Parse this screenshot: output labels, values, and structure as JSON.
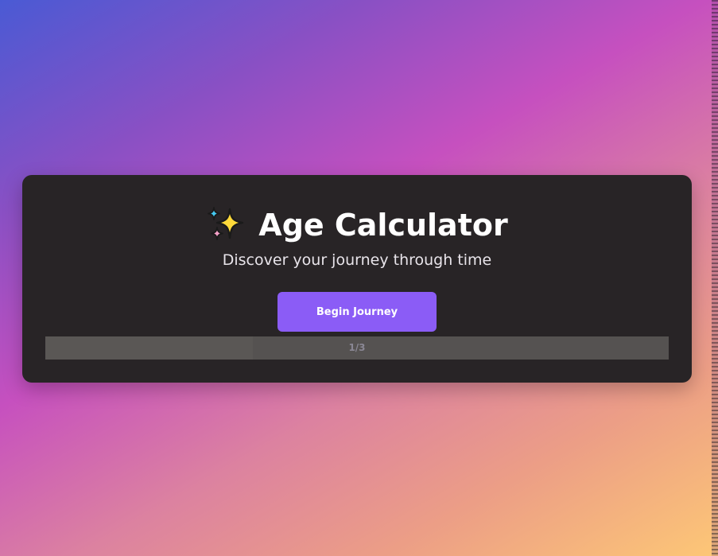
{
  "app": {
    "title_icon": "sparkles-icon",
    "title": "Age Calculator",
    "subtitle": "Discover your journey through time"
  },
  "actions": {
    "begin_label": "Begin Journey"
  },
  "progress": {
    "label": "1/3",
    "current": 1,
    "total": 3
  },
  "colors": {
    "card_background": "#282426",
    "accent": "#8b5cf6",
    "progress_track": "#555251",
    "gradient_start": "#4a5ad4",
    "gradient_mid": "#c650bf",
    "gradient_end": "#fdc776"
  }
}
